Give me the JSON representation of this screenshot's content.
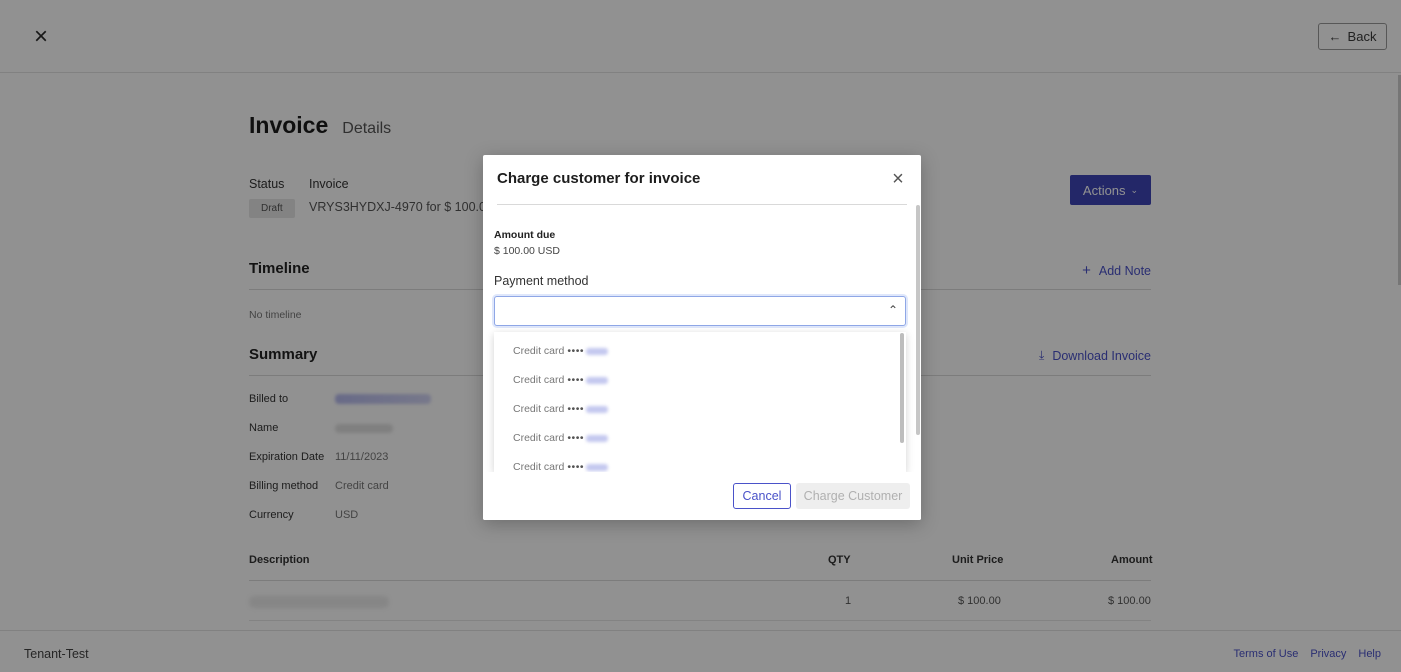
{
  "header": {
    "back_label": "Back"
  },
  "invoice": {
    "title": "Invoice",
    "subtitle": "Details",
    "status_label": "Status",
    "invoice_label": "Invoice",
    "status_badge": "Draft",
    "invoice_id": "VRYS3HYDXJ-4970 for $ 100.0",
    "actions_label": "Actions"
  },
  "timeline": {
    "title": "Timeline",
    "add_note_label": "Add Note",
    "empty_text": "No timeline"
  },
  "summary": {
    "title": "Summary",
    "download_label": "Download Invoice",
    "rows": [
      {
        "key": "Billed to",
        "value": ""
      },
      {
        "key": "Name",
        "value": ""
      },
      {
        "key": "Expiration Date",
        "value": "11/11/2023"
      },
      {
        "key": "Billing method",
        "value": "Credit card"
      },
      {
        "key": "Currency",
        "value": "USD"
      }
    ]
  },
  "table": {
    "headers": [
      "Description",
      "QTY",
      "Unit Price",
      "Amount"
    ],
    "rows": [
      {
        "description": "",
        "qty": "1",
        "unit_price": "$ 100.00",
        "amount": "$ 100.00"
      }
    ]
  },
  "footer": {
    "tenant": "Tenant-Test",
    "links": [
      "Terms of Use",
      "Privacy",
      "Help"
    ]
  },
  "modal": {
    "title": "Charge customer for invoice",
    "amount_due_label": "Amount due",
    "amount_due_value": "$ 100.00 USD",
    "payment_method_label": "Payment method",
    "payment_method_value": "",
    "options": [
      {
        "label": "Credit card",
        "mask": "••••"
      },
      {
        "label": "Credit card",
        "mask": "••••"
      },
      {
        "label": "Credit card",
        "mask": "••••"
      },
      {
        "label": "Credit card",
        "mask": "••••"
      },
      {
        "label": "Credit card",
        "mask": "••••"
      }
    ],
    "cancel_label": "Cancel",
    "charge_label": "Charge Customer"
  },
  "colors": {
    "accent": "#3f46b8",
    "link": "#4a52c9",
    "overlay": "#000000"
  },
  "icons": {
    "close": "close-icon",
    "back": "arrow-left-icon",
    "actions": "chevron-down-icon",
    "add_note": "plus-icon",
    "download": "download-icon",
    "select": "chevron-up-icon"
  }
}
